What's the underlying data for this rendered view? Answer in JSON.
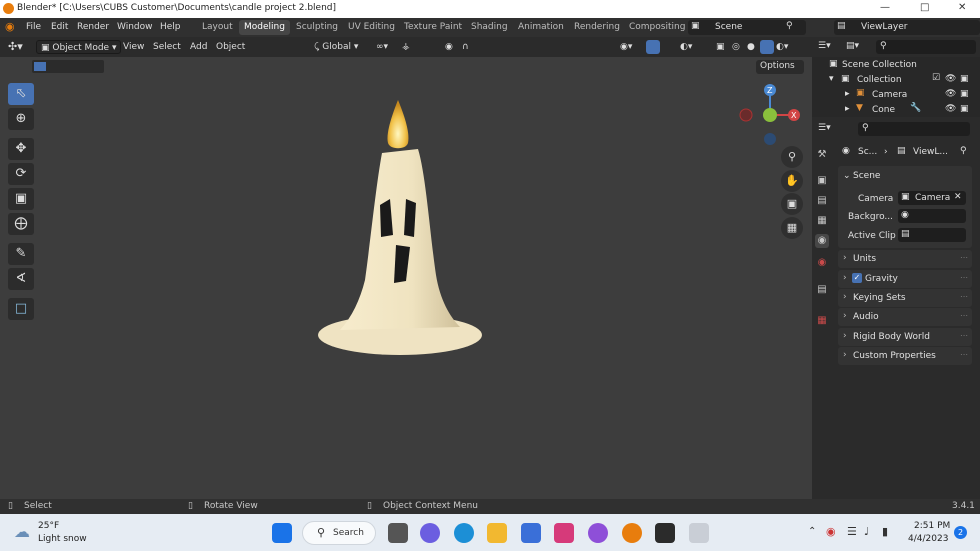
{
  "window": {
    "title": "Blender* [C:\\Users\\CUBS Customer\\Documents\\candle project 2.blend]"
  },
  "menu": {
    "items": [
      "File",
      "Edit",
      "Render",
      "Window",
      "Help"
    ]
  },
  "workspaces": [
    "Layout",
    "Modeling",
    "Sculpting",
    "UV Editing",
    "Texture Paint",
    "Shading",
    "Animation",
    "Rendering",
    "Compositing"
  ],
  "active_workspace": "Modeling",
  "scene_name": "Scene",
  "view_layer": "ViewLayer",
  "viewport_header": {
    "mode": "Object Mode",
    "menus": [
      "View",
      "Select",
      "Add",
      "Object"
    ],
    "transform_orientation": "Global",
    "options_label": "Options"
  },
  "gizmo": {
    "z": "Z",
    "x": "X"
  },
  "outliner": {
    "root": "Scene Collection",
    "collection": "Collection",
    "objects": [
      "Camera",
      "Cone"
    ]
  },
  "properties": {
    "breadcrumb": [
      "Sc...",
      "ViewL..."
    ],
    "scene_section": "Scene",
    "camera_label": "Camera",
    "camera_value": "Camera",
    "background_label": "Backgro...",
    "active_clip_label": "Active Clip",
    "panels": [
      "Units",
      "Gravity",
      "Keying Sets",
      "Audio",
      "Rigid Body World",
      "Custom Properties"
    ],
    "gravity_checked": true
  },
  "statusbar": {
    "select": "Select",
    "rotate": "Rotate View",
    "context": "Object Context Menu",
    "version": "3.4.1"
  },
  "taskbar": {
    "temperature": "25°F",
    "weather": "Light snow",
    "search": "Search",
    "time": "2:51 PM",
    "date": "4/4/2023",
    "notification_count": "2"
  }
}
